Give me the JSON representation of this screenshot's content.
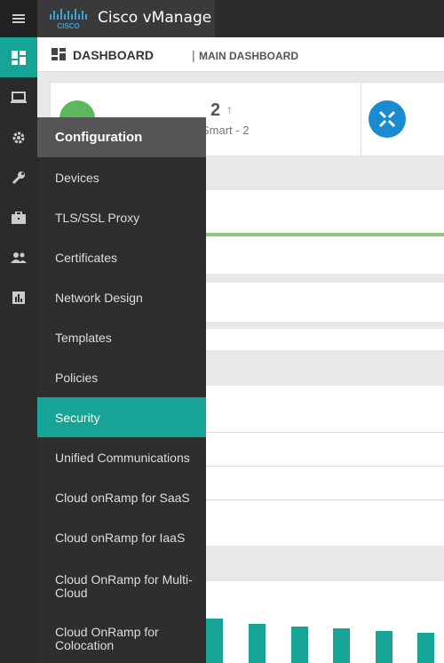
{
  "app": {
    "title": "Cisco vManage",
    "logo_text": "CISCO"
  },
  "breadcrumb": {
    "title": "DASHBOARD",
    "separator": "|",
    "subtitle": "MAIN DASHBOARD"
  },
  "rail": {
    "items": [
      {
        "icon": "dashboard-icon",
        "active": true
      },
      {
        "icon": "monitor-icon",
        "active": false
      },
      {
        "icon": "gear-icon",
        "active": false
      },
      {
        "icon": "wrench-icon",
        "active": false
      },
      {
        "icon": "briefcase-icon",
        "active": false
      },
      {
        "icon": "users-icon",
        "active": false
      },
      {
        "icon": "analytics-icon",
        "active": false
      }
    ]
  },
  "summary_card": {
    "count": "2",
    "trend": "↑",
    "sub": "Smart - 2"
  },
  "menu": {
    "header": "Configuration",
    "items": [
      "Devices",
      "TLS/SSL Proxy",
      "Certificates",
      "Network Design",
      "Templates",
      "Policies",
      "Security",
      "Unified Communications",
      "Cloud onRamp for SaaS",
      "Cloud onRamp for IaaS",
      "Cloud OnRamp for Multi-Cloud",
      "Cloud OnRamp for Colocation"
    ],
    "active_item": "Security"
  },
  "colors": {
    "accent": "#17a396",
    "topbar": "#2b2b2b",
    "menu_bg": "#2e2e2e",
    "menu_header": "#555555"
  }
}
